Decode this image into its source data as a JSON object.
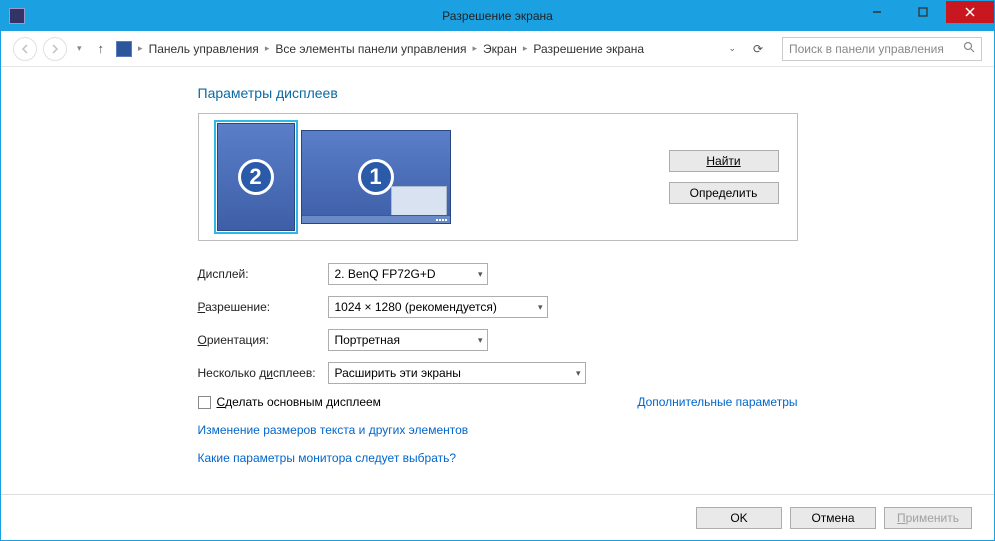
{
  "window": {
    "title": "Разрешение экрана"
  },
  "breadcrumb": {
    "items": [
      "Панель управления",
      "Все элементы панели управления",
      "Экран",
      "Разрешение экрана"
    ]
  },
  "search": {
    "placeholder": "Поиск в панели управления"
  },
  "heading": "Параметры дисплеев",
  "monitors": {
    "m1_label": "1",
    "m2_label": "2"
  },
  "buttons": {
    "detect": "Найти",
    "identify": "Определить",
    "ok": "OK",
    "cancel": "Отмена",
    "apply": "Применить"
  },
  "form": {
    "display_label": "Дисплей:",
    "display_value": "2. BenQ FP72G+D",
    "resolution_label": "Разрешение:",
    "resolution_value": "1024 × 1280 (рекомендуется)",
    "orientation_label": "Ориентация:",
    "orientation_value": "Портретная",
    "multi_label": "Несколько дисплеев:",
    "multi_value": "Расширить эти экраны"
  },
  "checkbox": {
    "label": "Сделать основным дисплеем"
  },
  "links": {
    "advanced": "Дополнительные параметры",
    "textsize": "Изменение размеров текста и других элементов",
    "which": "Какие параметры монитора следует выбрать?"
  }
}
